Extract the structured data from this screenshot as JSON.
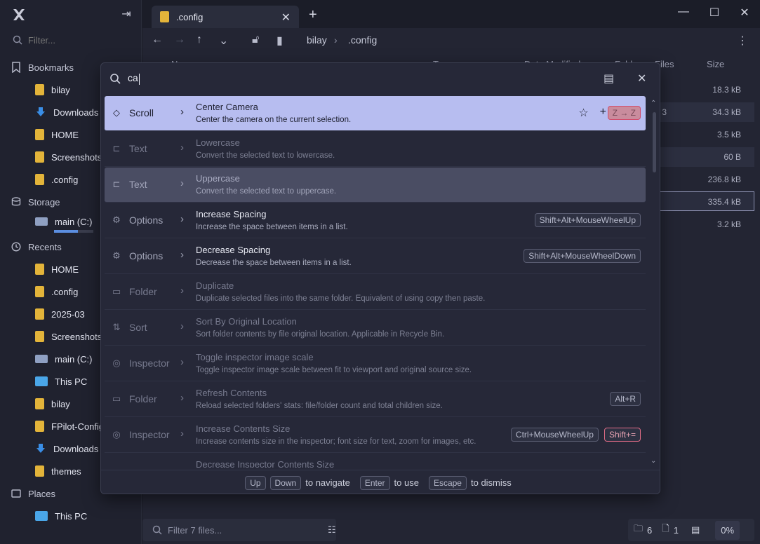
{
  "sidebar": {
    "filter_placeholder": "Filter...",
    "bookmarks_label": "Bookmarks",
    "bookmarks": [
      "bilay",
      "Downloads",
      "HOME",
      "Screenshots",
      ".config"
    ],
    "storage_label": "Storage",
    "storage_drive": "main (C:)",
    "storage_fill": 0.6,
    "recents_label": "Recents",
    "recents": [
      "HOME",
      ".config",
      "2025-03",
      "Screenshots",
      "main (C:)",
      "This PC",
      "bilay",
      "FPilot-Config",
      "Downloads",
      "themes"
    ],
    "places_label": "Places",
    "places": [
      "This PC"
    ]
  },
  "tab": {
    "label": ".config"
  },
  "breadcrumb": [
    "bilay",
    ".config"
  ],
  "columns": {
    "name": "N",
    "type": "T",
    "date": "Date Modified",
    "folders": "Fold",
    "files": "Files",
    "size": "Size"
  },
  "file_sizes": [
    "18.3 kB",
    "34.3 kB",
    "3.5 kB",
    "60 B",
    "236.8 kB",
    "335.4 kB",
    "3.2 kB"
  ],
  "row_fragment": "3",
  "bottom": {
    "filter_placeholder": "Filter 7 files...",
    "folder_count": "6",
    "file_count": "1",
    "percent": "0%"
  },
  "palette": {
    "query": "ca",
    "commands": [
      {
        "category": "Scroll",
        "title": "Center Camera",
        "desc": "Center the camera on the current selection.",
        "keys": [
          {
            "k": "Z → Z",
            "warn": true
          }
        ]
      },
      {
        "category": "Text",
        "title": "Lowercase",
        "desc": "Convert the selected text to lowercase.",
        "keys": []
      },
      {
        "category": "Text",
        "title": "Uppercase",
        "desc": "Convert the selected text to uppercase.",
        "keys": []
      },
      {
        "category": "Options",
        "title": "Increase Spacing",
        "desc": "Increase the space between items in a list.",
        "keys": [
          {
            "k": "Shift+Alt+MouseWheelUp",
            "warn": false
          }
        ]
      },
      {
        "category": "Options",
        "title": "Decrease Spacing",
        "desc": "Decrease the space between items in a list.",
        "keys": [
          {
            "k": "Shift+Alt+MouseWheelDown",
            "warn": false
          }
        ]
      },
      {
        "category": "Folder",
        "title": "Duplicate",
        "desc": "Duplicate selected files into the same folder. Equivalent of using copy then paste.",
        "keys": []
      },
      {
        "category": "Sort",
        "title": "Sort By Original Location",
        "desc": "Sort folder contents by file original location. Applicable in Recycle Bin.",
        "keys": []
      },
      {
        "category": "Inspector",
        "title": "Toggle inspector image scale",
        "desc": "Toggle inspector image scale between fit to viewport and original source size.",
        "keys": []
      },
      {
        "category": "Folder",
        "title": "Refresh Contents",
        "desc": "Reload selected folders' stats: file/folder count and total children size.",
        "keys": [
          {
            "k": "Alt+R",
            "warn": false
          }
        ]
      },
      {
        "category": "Inspector",
        "title": "Increase Contents Size",
        "desc": "Increase contents size in the inspector; font size for text, zoom for images, etc.",
        "keys": [
          {
            "k": "Ctrl+MouseWheelUp",
            "warn": false
          },
          {
            "k": "Shift+=",
            "warn": true
          }
        ]
      },
      {
        "category": "",
        "title": "Decrease Inspector Contents Size",
        "desc": "",
        "keys": []
      }
    ],
    "footer": {
      "up": "Up",
      "down": "Down",
      "navigate": "to navigate",
      "enter": "Enter",
      "use": "to use",
      "escape": "Escape",
      "dismiss": "to dismiss"
    }
  }
}
